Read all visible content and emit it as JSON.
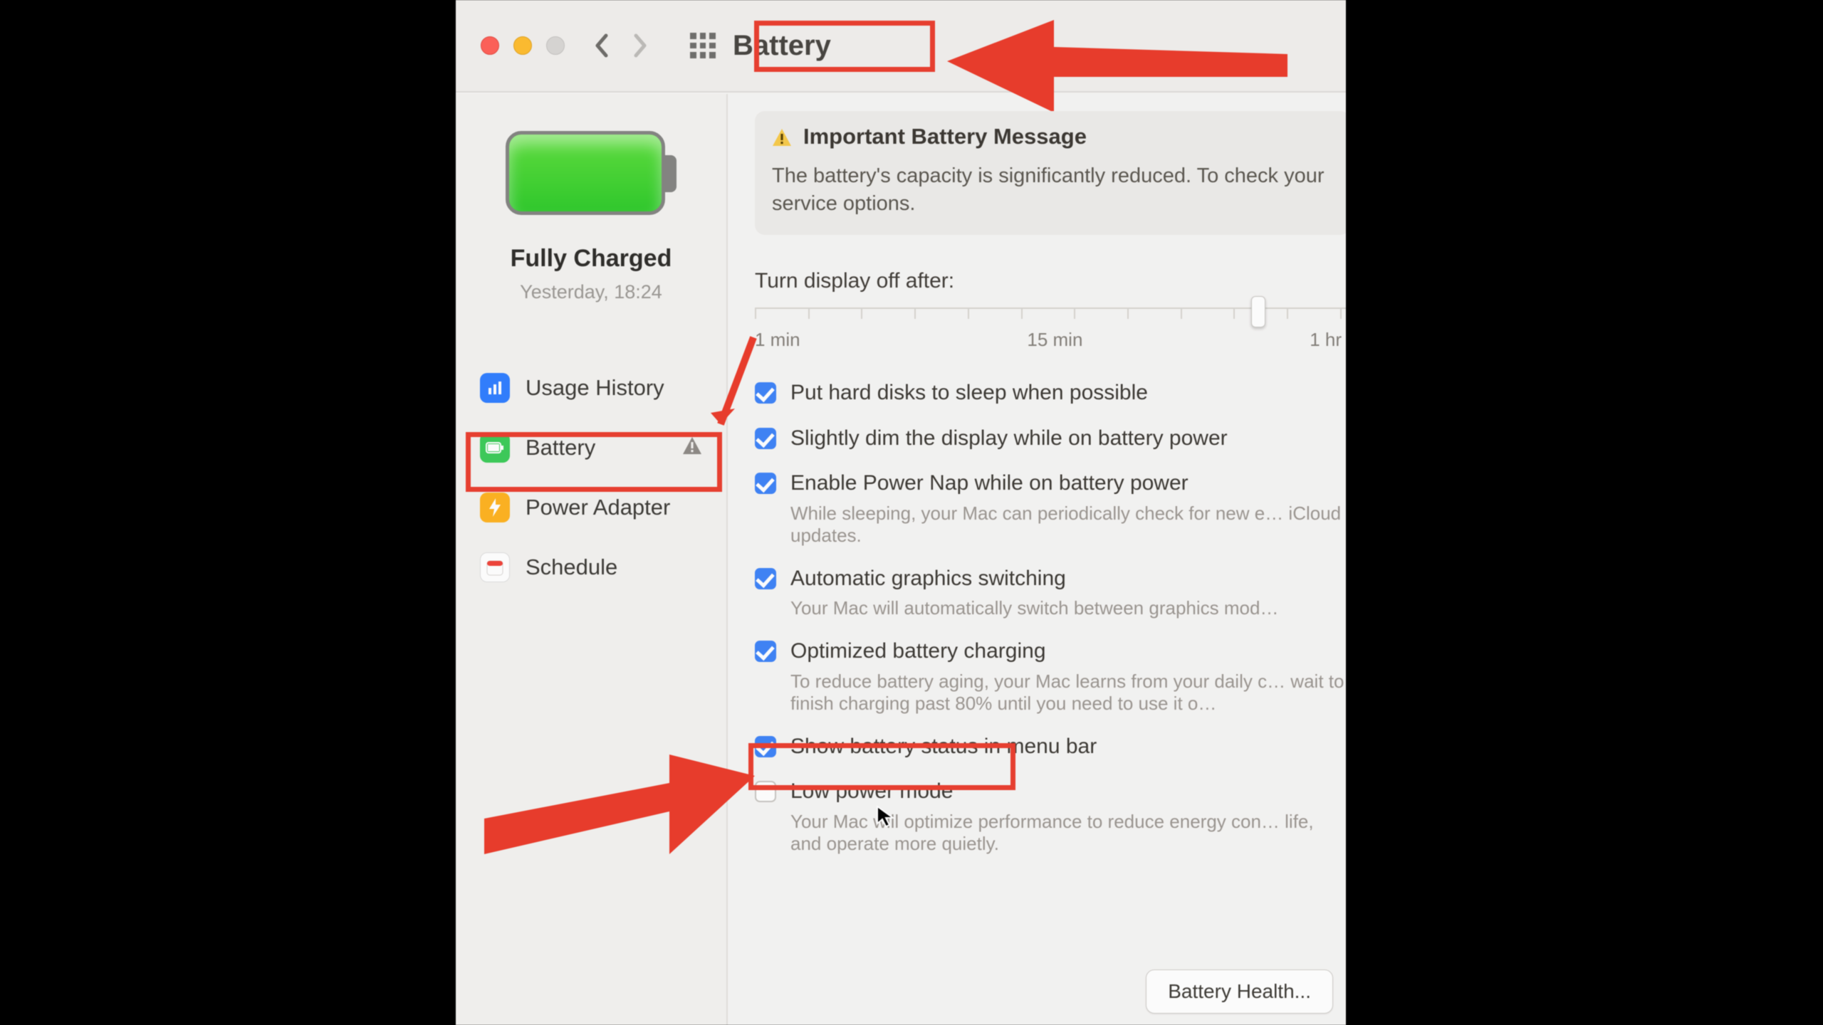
{
  "titlebar": {
    "grid_icon": "apps-grid-icon",
    "title": "Battery"
  },
  "sidebar": {
    "battery_status": "Fully Charged",
    "battery_time": "Yesterday, 18:24",
    "items": [
      {
        "label": "Usage History",
        "icon": "chart-icon"
      },
      {
        "label": "Battery",
        "icon": "battery-icon",
        "warning": true,
        "selected": true
      },
      {
        "label": "Power Adapter",
        "icon": "bolt-icon"
      },
      {
        "label": "Schedule",
        "icon": "calendar-icon"
      }
    ]
  },
  "message": {
    "title": "Important Battery Message",
    "body": "The battery's capacity is significantly reduced. To check your service options."
  },
  "slider": {
    "label": "Turn display off after:",
    "ticks": [
      "1 min",
      "15 min",
      "1 hr"
    ],
    "thumb_pct": 84
  },
  "options": [
    {
      "checked": true,
      "label": "Put hard disks to sleep when possible"
    },
    {
      "checked": true,
      "label": "Slightly dim the display while on battery power"
    },
    {
      "checked": true,
      "label": "Enable Power Nap while on battery power",
      "desc": "While sleeping, your Mac can periodically check for new e… iCloud updates."
    },
    {
      "checked": true,
      "label": "Automatic graphics switching",
      "desc": "Your Mac will automatically switch between graphics mod…"
    },
    {
      "checked": true,
      "label": "Optimized battery charging",
      "desc": "To reduce battery aging, your Mac learns from your daily c… wait to finish charging past 80% until you need to use it o…"
    },
    {
      "checked": true,
      "label": "Show battery status in menu bar"
    },
    {
      "checked": false,
      "label": "Low power mode",
      "desc": "Your Mac will optimize performance to reduce energy con… life, and operate more quietly."
    }
  ],
  "buttons": {
    "battery_health": "Battery Health..."
  },
  "annotations": {
    "title_highlight": true,
    "sidebar_battery_highlight": true,
    "low_power_highlight": true
  }
}
